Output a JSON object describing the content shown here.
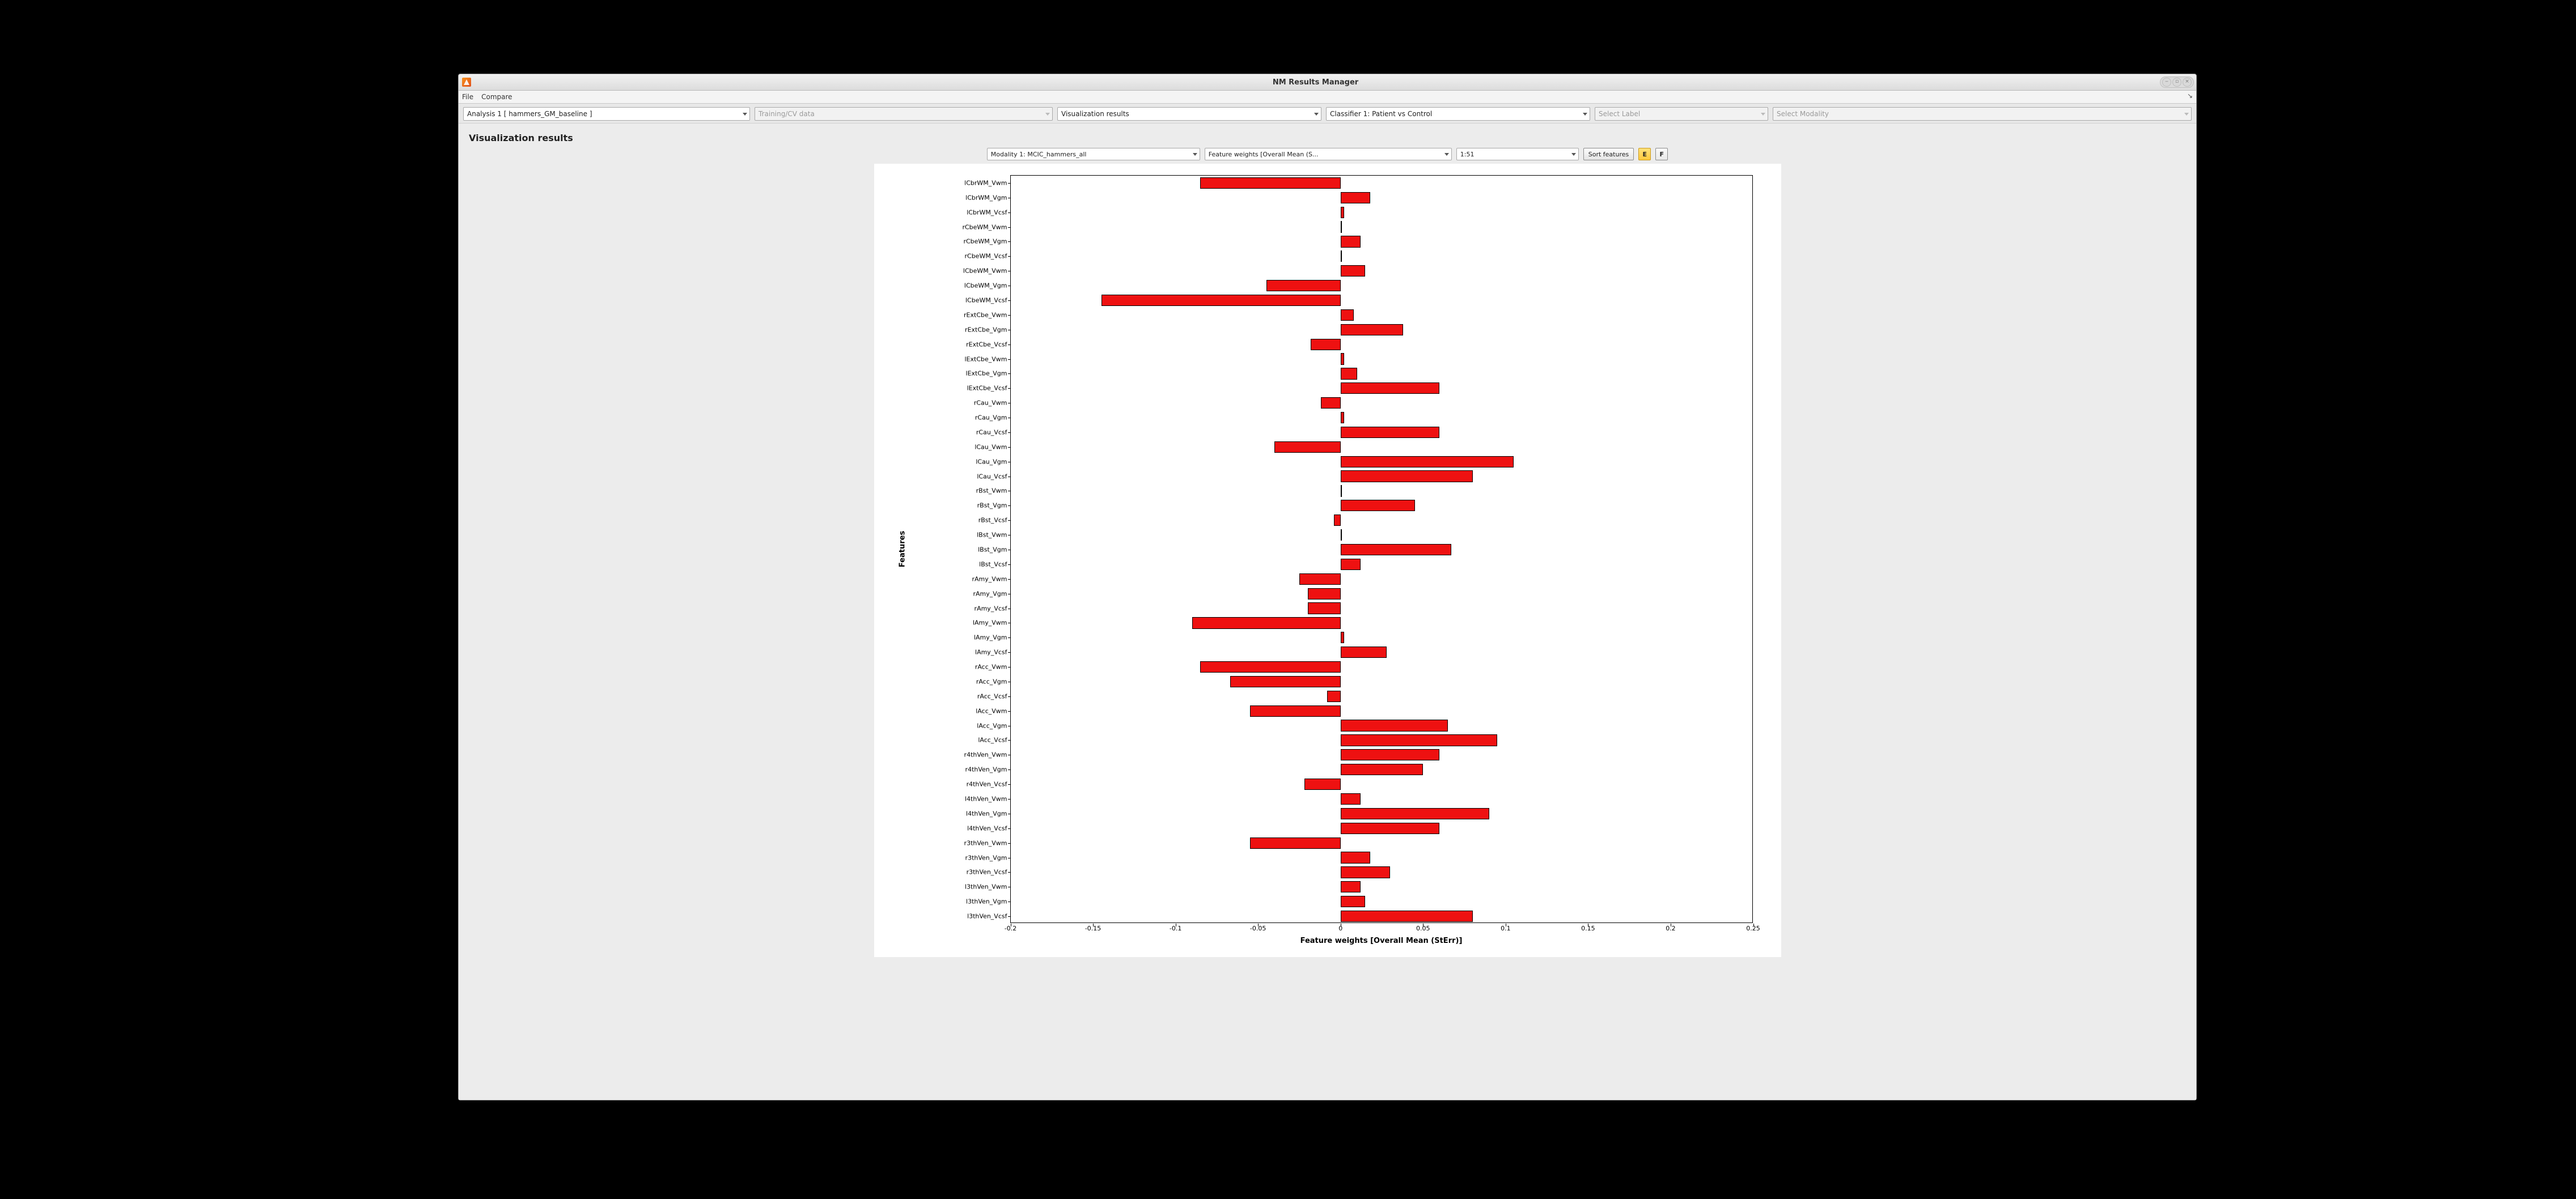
{
  "window": {
    "title": "NM Results Manager"
  },
  "menubar": {
    "file": "File",
    "compare": "Compare"
  },
  "toolbar": {
    "analysis": "Analysis 1 [ hammers_GM_baseline ]",
    "data": "Training/CV data",
    "view": "Visualization results",
    "classifier": "Classifier 1: Patient vs Control",
    "label": "Select Label",
    "modality": "Select Modality"
  },
  "section_title": "Visualization results",
  "plot_toolbar": {
    "modality": "Modality 1: MCIC_hammers_all",
    "metric": "Feature weights [Overall Mean (S...",
    "range": "1:51",
    "sort": "Sort features",
    "btn_e": "E",
    "btn_f": "F"
  },
  "chart_data": {
    "type": "bar",
    "orientation": "horizontal",
    "xlabel": "Feature weights [Overall Mean (StErr)]",
    "ylabel": "Features",
    "xlim": [
      -0.2,
      0.25
    ],
    "xticks": [
      -0.2,
      -0.15,
      -0.1,
      -0.05,
      0,
      0.05,
      0.1,
      0.15,
      0.2,
      0.25
    ],
    "categories": [
      "lCbrWM_Vwm",
      "lCbrWM_Vgm",
      "lCbrWM_Vcsf",
      "rCbeWM_Vwm",
      "rCbeWM_Vgm",
      "rCbeWM_Vcsf",
      "lCbeWM_Vwm",
      "lCbeWM_Vgm",
      "lCbeWM_Vcsf",
      "rExtCbe_Vwm",
      "rExtCbe_Vgm",
      "rExtCbe_Vcsf",
      "lExtCbe_Vwm",
      "lExtCbe_Vgm",
      "lExtCbe_Vcsf",
      "rCau_Vwm",
      "rCau_Vgm",
      "rCau_Vcsf",
      "lCau_Vwm",
      "lCau_Vgm",
      "lCau_Vcsf",
      "rBst_Vwm",
      "rBst_Vgm",
      "rBst_Vcsf",
      "lBst_Vwm",
      "lBst_Vgm",
      "lBst_Vcsf",
      "rAmy_Vwm",
      "rAmy_Vgm",
      "rAmy_Vcsf",
      "lAmy_Vwm",
      "lAmy_Vgm",
      "lAmy_Vcsf",
      "rAcc_Vwm",
      "rAcc_Vgm",
      "rAcc_Vcsf",
      "lAcc_Vwm",
      "lAcc_Vgm",
      "lAcc_Vcsf",
      "r4thVen_Vwm",
      "r4thVen_Vgm",
      "r4thVen_Vcsf",
      "l4thVen_Vwm",
      "l4thVen_Vgm",
      "l4thVen_Vcsf",
      "r3thVen_Vwm",
      "r3thVen_Vgm",
      "r3thVen_Vcsf",
      "l3thVen_Vwm",
      "l3thVen_Vgm",
      "l3thVen_Vcsf"
    ],
    "values": [
      -0.085,
      0.018,
      0.002,
      0.0,
      0.012,
      0.0,
      0.015,
      -0.045,
      -0.145,
      0.008,
      0.038,
      -0.018,
      0.002,
      0.01,
      0.06,
      -0.012,
      0.002,
      0.06,
      -0.04,
      0.105,
      0.08,
      0.0,
      0.045,
      -0.004,
      0.0,
      0.067,
      0.012,
      -0.025,
      -0.02,
      -0.02,
      -0.09,
      0.002,
      0.028,
      -0.085,
      -0.067,
      -0.008,
      -0.055,
      0.065,
      0.095,
      0.06,
      0.05,
      -0.022,
      0.012,
      0.09,
      0.06,
      -0.055,
      0.018,
      0.03,
      0.012,
      0.015,
      0.08
    ],
    "bar_color": "#ee1111"
  }
}
